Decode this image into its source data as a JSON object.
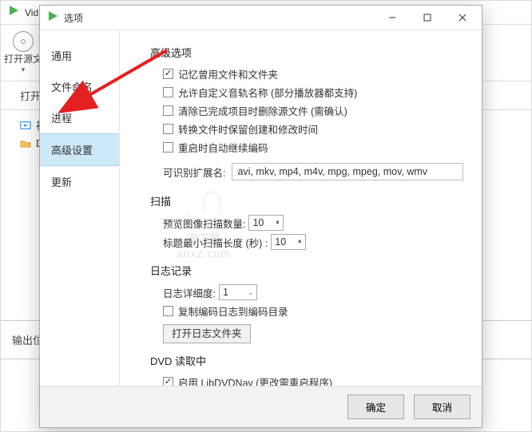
{
  "bg": {
    "title": "Vid",
    "open_btn": "打开源文",
    "tabs_label": "打开",
    "list": {
      "video": "视",
      "folder": "D"
    },
    "output_label": "输出位"
  },
  "dialog": {
    "title": "选项",
    "sidebar": {
      "general": "通用",
      "filenaming": "文件命名",
      "process": "进程",
      "advanced": "高级设置",
      "update": "更新"
    },
    "sections": {
      "advanced_options": "高级选项",
      "scan": "扫描",
      "logging": "日志记录",
      "dvd": "DVD 读取中"
    },
    "adv": {
      "remember": "记忆曾用文件和文件夹",
      "custom_track": "允许自定义音轨名称 (部分播放器都支持)",
      "delete_source": "清除已完成项目时删除源文件 (需确认)",
      "keep_times": "转换文件时保留创建和修改时间",
      "resume_encoding": "重启时自动继续编码",
      "ext_label": "可识别扩展名:",
      "ext_value": "avi, mkv, mp4, m4v, mpg, mpeg, mov, wmv"
    },
    "scan": {
      "preview_label": "预览图像扫描数量:",
      "preview_value": "10",
      "title_len_label": "标题最小扫描长度 (秒) :",
      "title_len_value": "10"
    },
    "logging": {
      "verbosity_label": "日志详细度:",
      "verbosity_value": "1",
      "copy_log": "复制编码日志到编码目录",
      "open_log_btn": "打开日志文件夹"
    },
    "dvd": {
      "enable_libdvdnav": "启用 LibDVDNav (更改需重启程序)"
    },
    "buttons": {
      "ok": "确定",
      "cancel": "取消"
    }
  }
}
